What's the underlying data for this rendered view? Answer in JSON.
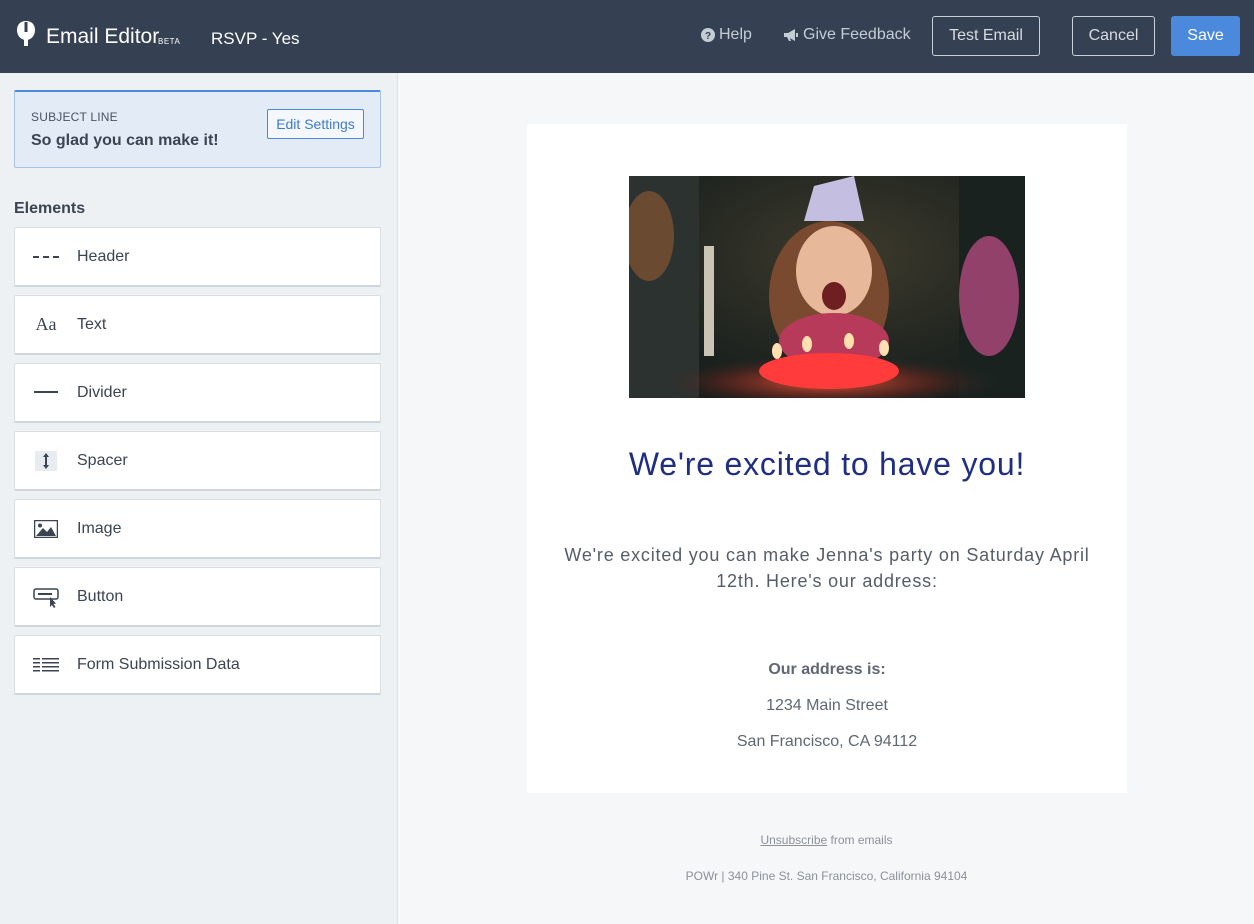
{
  "header": {
    "app_title": "Email Editor",
    "beta_badge": "BETA",
    "document_title": "RSVP - Yes",
    "help_label": "Help",
    "feedback_label": "Give Feedback",
    "test_email_label": "Test Email",
    "cancel_label": "Cancel",
    "save_label": "Save"
  },
  "sidebar": {
    "subject_label": "SUBJECT LINE",
    "subject_value": "So glad you can make it!",
    "edit_settings_label": "Edit Settings",
    "elements_title": "Elements",
    "elements": [
      {
        "label": "Header",
        "icon": "dashed-line-icon"
      },
      {
        "label": "Text",
        "icon": "text-aa-icon"
      },
      {
        "label": "Divider",
        "icon": "divider-line-icon"
      },
      {
        "label": "Spacer",
        "icon": "vertical-arrows-icon"
      },
      {
        "label": "Image",
        "icon": "image-icon"
      },
      {
        "label": "Button",
        "icon": "button-cursor-icon"
      },
      {
        "label": "Form Submission Data",
        "icon": "lines-grid-icon"
      }
    ]
  },
  "email": {
    "headline": "We're excited to have you!",
    "body": "We're excited you can make Jenna's party on Saturday April 12th. Here's our address:",
    "address_title": "Our address is:",
    "address_line1": "1234 Main Street",
    "address_line2": "San Francisco, CA 94112",
    "unsubscribe_link": "Unsubscribe",
    "unsubscribe_suffix": " from emails",
    "footer_address": "POWr | 340 Pine St. San Francisco, California 94104"
  },
  "colors": {
    "topbar": "#354152",
    "accent": "#4a89dc",
    "headline": "#1f2e80"
  }
}
